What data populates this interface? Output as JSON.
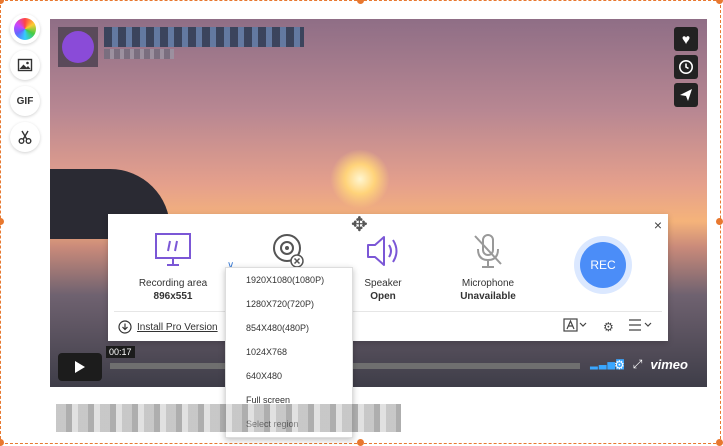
{
  "recorder_panel": {
    "recording_area": {
      "label": "Recording area",
      "value": "896x551"
    },
    "speaker": {
      "label": "Speaker",
      "value": "Open"
    },
    "microphone": {
      "label": "Microphone",
      "value": "Unavailable"
    },
    "rec_label": "REC",
    "install_label": "Install Pro Version",
    "close_glyph": "×"
  },
  "resolution_menu": {
    "items": [
      "1920X1080(1080P)",
      "1280X720(720P)",
      "854X480(480P)",
      "1024X768",
      "640X480",
      "Full screen",
      "Select region"
    ]
  },
  "left_toolbar": {
    "gif_label": "GIF"
  },
  "player": {
    "time": "00:17",
    "brand": "vimeo"
  },
  "colors": {
    "accent": "#4b8df8",
    "icon_purple": "#7b57d6",
    "frame_orange": "#e8782f"
  }
}
